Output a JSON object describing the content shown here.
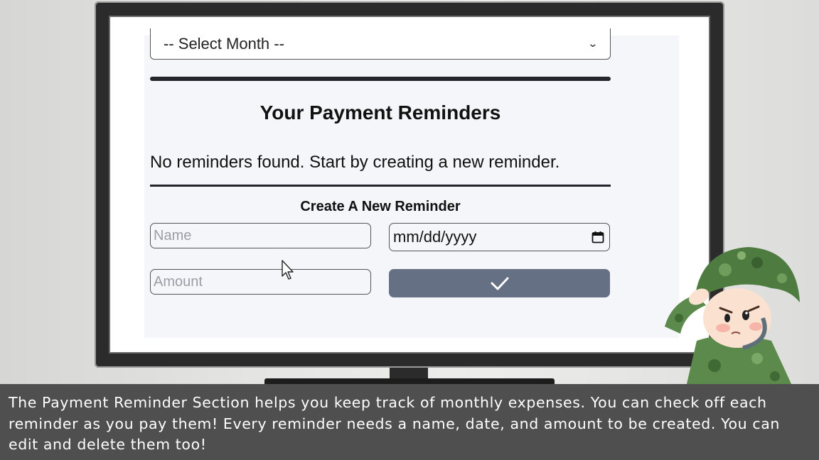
{
  "app": {
    "month_select": {
      "value": "-- Select Month --",
      "chevron_icon": "chevron-down-icon"
    },
    "reminders": {
      "title": "Your Payment Reminders",
      "empty_message": "No reminders found. Start by creating a new reminder."
    },
    "create_form": {
      "title": "Create A New Reminder",
      "name_placeholder": "Name",
      "date_placeholder": "mm/dd/yyyy",
      "amount_placeholder": "Amount",
      "submit_icon": "checkmark-icon",
      "calendar_icon": "calendar-icon"
    },
    "colors": {
      "submit_button": "#667084",
      "divider": "#23252b",
      "app_background": "#f5f6f9"
    }
  },
  "caption": {
    "text": "The Payment Reminder Section helps you keep track of monthly expenses. You can check off each reminder as you pay them! Every reminder needs a name, date, and amount to be created. You can edit and delete them too!"
  }
}
